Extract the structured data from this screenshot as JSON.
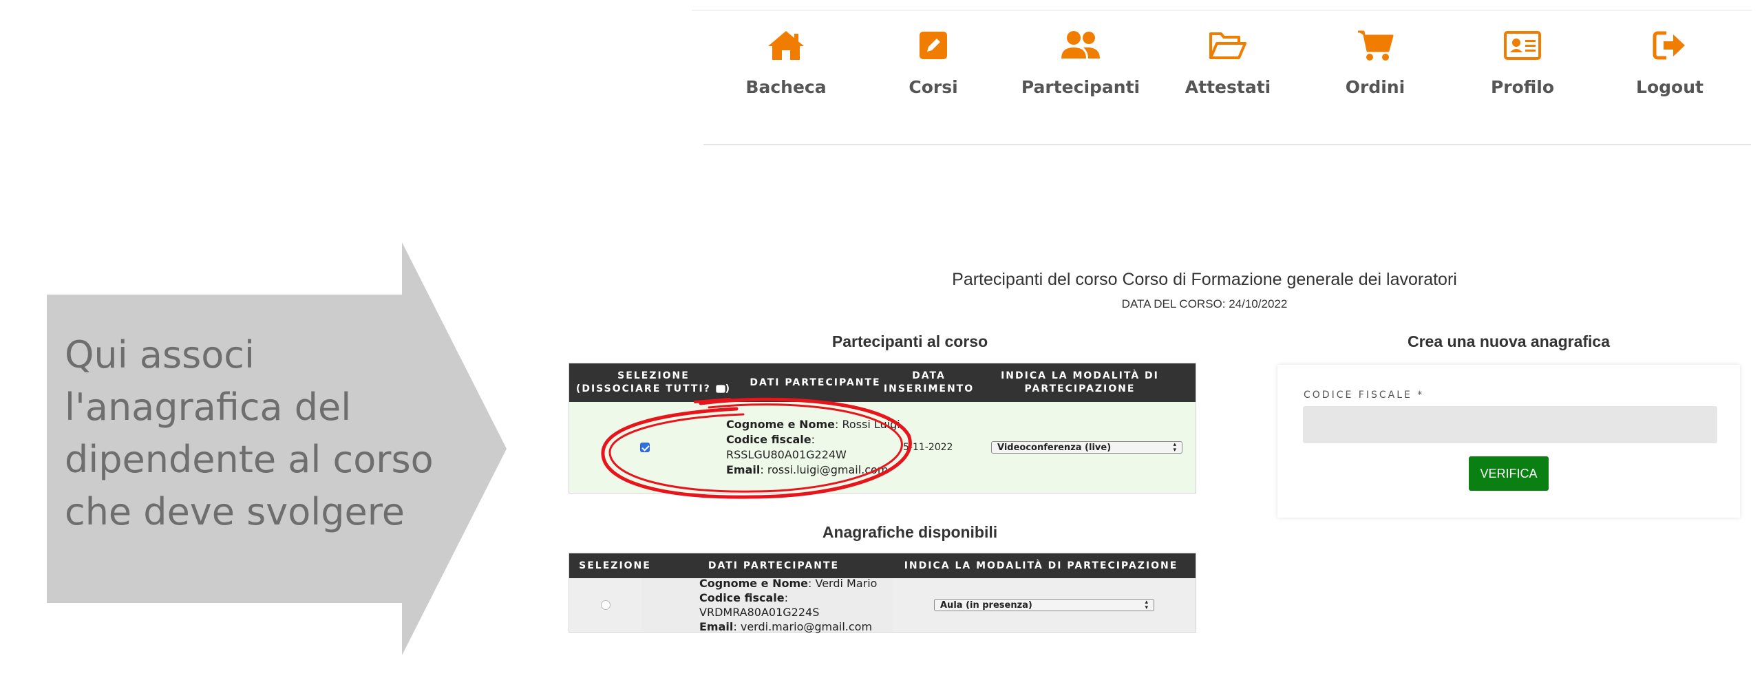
{
  "nav": {
    "items": [
      {
        "label": "Bacheca",
        "icon": "home-icon"
      },
      {
        "label": "Corsi",
        "icon": "edit-icon"
      },
      {
        "label": "Partecipanti",
        "icon": "users-icon"
      },
      {
        "label": "Attestati",
        "icon": "folder-open-icon"
      },
      {
        "label": "Ordini",
        "icon": "cart-icon"
      },
      {
        "label": "Profilo",
        "icon": "id-card-icon"
      },
      {
        "label": "Logout",
        "icon": "sign-out-icon"
      }
    ],
    "accent_color": "#f07d00"
  },
  "callout": {
    "lines": [
      "Qui associ",
      "l'anagrafica del",
      "dipendente al corso",
      "che deve svolgere"
    ],
    "color": "#cccccc"
  },
  "course": {
    "title": "Partecipanti del corso Corso di Formazione generale dei lavoratori",
    "date_line": "DATA DEL CORSO: 24/10/2022"
  },
  "enrolled": {
    "title": "Partecipanti al corso",
    "headers": {
      "select": "SELEZIONE (DISSOCIARE TUTTI?",
      "select_close": ")",
      "data": "DATI PARTECIPANTE",
      "date": "DATA INSERIMENTO",
      "mode": "INDICA LA MODALITÀ DI PARTECIPAZIONE"
    },
    "rows": [
      {
        "name_label": "Cognome e Nome",
        "name": "Rossi Luigi",
        "cf_label": "Codice fiscale",
        "cf": "RSSLGU80A01G224W",
        "email_label": "Email",
        "email": "rossi.luigi@gmail.com",
        "date": "5-11-2022",
        "mode": "Videoconferenza (live)",
        "checked": true
      }
    ],
    "row_color": "#eef9ea"
  },
  "available": {
    "title": "Anagrafiche disponibili",
    "headers": {
      "select": "SELEZIONE",
      "data": "DATI PARTECIPANTE",
      "mode": "INDICA LA MODALITÀ DI PARTECIPAZIONE"
    },
    "rows": [
      {
        "name_label": "Cognome e Nome",
        "name": "Verdi Mario",
        "cf_label": "Codice fiscale",
        "cf": "VRDMRA80A01G224S",
        "email_label": "Email",
        "email": "verdi.mario@gmail.com",
        "mode": "Aula (in presenza)",
        "checked": false
      }
    ]
  },
  "new_record": {
    "title": "Crea una nuova anagrafica",
    "field_label": "CODICE FISCALE *",
    "field_value": "",
    "button": "VERIFICA",
    "button_color": "#0a8012"
  },
  "annotation": {
    "shape": "red-hand-drawn-ellipse",
    "color": "#e8141c"
  }
}
